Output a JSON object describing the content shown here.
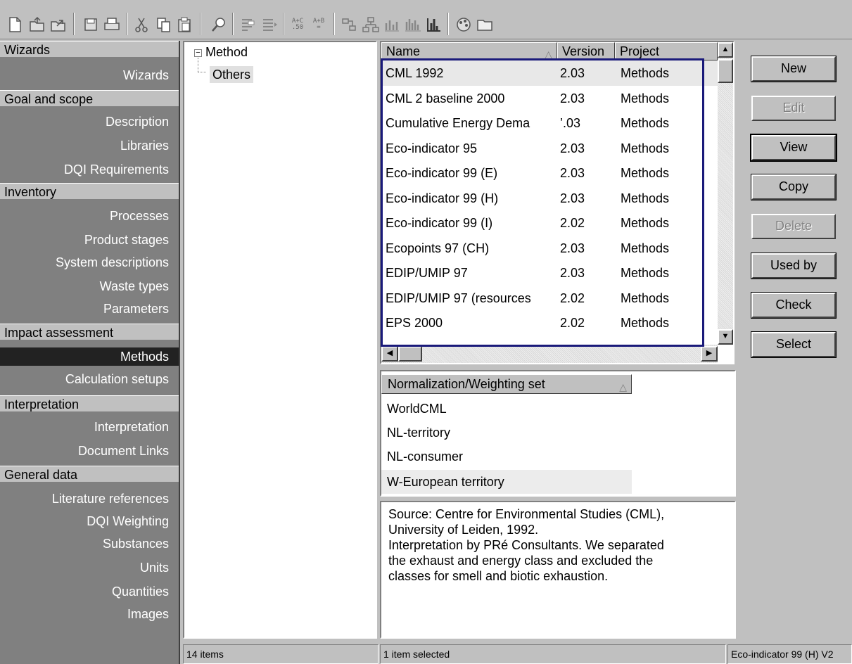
{
  "toolbar": {
    "icons": [
      "new-file-icon",
      "open-folder-icon",
      "open-up-icon",
      "save-icon",
      "print-icon",
      "cut-icon",
      "copy-icon",
      "paste-icon",
      "search-icon",
      "indent-left-icon",
      "indent-right-icon",
      "formula-icon",
      "compare-icon",
      "network-icon",
      "tree-icon",
      "bar-chart-icon",
      "bar-chart-2-icon",
      "chart-3-icon",
      "palette-icon",
      "folder-icon"
    ],
    "formula_a_top": "A+C",
    "formula_a_bot": ".50",
    "formula_b_top": "A+B",
    "formula_b_bot": "="
  },
  "navigator": {
    "sections": [
      {
        "title": "Wizards",
        "items": [
          "Wizards"
        ]
      },
      {
        "title": "Goal and scope",
        "items": [
          "Description",
          "Libraries",
          "DQI Requirements"
        ]
      },
      {
        "title": "Inventory",
        "items": [
          "Processes",
          "Product stages",
          "System descriptions",
          "Waste types",
          "Parameters"
        ]
      },
      {
        "title": "Impact assessment",
        "items": [
          "Methods",
          "Calculation setups"
        ]
      },
      {
        "title": "Interpretation",
        "items": [
          "Interpretation",
          "Document Links"
        ]
      },
      {
        "title": "General data",
        "items": [
          "Literature references",
          "DQI Weighting",
          "Substances",
          "Units",
          "Quantities",
          "Images"
        ]
      }
    ],
    "selected": "Methods"
  },
  "tree": {
    "root": "Method",
    "child": "Others",
    "expander": "−"
  },
  "methods": {
    "columns": [
      "Name",
      "Version",
      "Project"
    ],
    "sort_indicator": "△",
    "rows": [
      [
        "CML 1992",
        "2.03",
        "Methods"
      ],
      [
        "CML 2 baseline 2000",
        "2.03",
        "Methods"
      ],
      [
        "Cumulative Energy Dema",
        "’.03",
        "Methods"
      ],
      [
        "Eco-indicator 95",
        "2.03",
        "Methods"
      ],
      [
        "Eco-indicator 99 (E)",
        "2.03",
        "Methods"
      ],
      [
        "Eco-indicator 99 (H)",
        "2.03",
        "Methods"
      ],
      [
        "Eco-indicator 99 (I)",
        "2.02",
        "Methods"
      ],
      [
        "Ecopoints 97 (CH)",
        "2.03",
        "Methods"
      ],
      [
        "EDIP/UMIP 97",
        "2.03",
        "Methods"
      ],
      [
        "EDIP/UMIP 97 (resources",
        "2.02",
        "Methods"
      ],
      [
        "EPS 2000",
        "2.02",
        "Methods"
      ]
    ],
    "scroll_up": "▲",
    "scroll_down": "▼",
    "scroll_left": "◀",
    "scroll_right": "▶"
  },
  "buttons": {
    "new": "New",
    "edit": "Edit",
    "view": "View",
    "copy": "Copy",
    "delete": "Delete",
    "used_by": "Used by",
    "check": "Check",
    "select": "Select"
  },
  "normalization": {
    "header": "Normalization/Weighting set",
    "sort_indicator": "△",
    "items": [
      "WorldCML",
      "NL-territory",
      "NL-consumer",
      "W-European territory"
    ]
  },
  "description": {
    "text": "Source: Centre for Environmental Studies (CML),\nUniversity of Leiden, 1992.\nInterpretation by PRé Consultants. We separated\nthe exhaust and energy class and excluded the\nclasses for smell and biotic exhaustion."
  },
  "status": {
    "items_count": "14 items",
    "selected_count": "1 item selected",
    "current_method": "Eco-indicator 99 (H) V2"
  },
  "colors": {
    "highlight_border": "#1a1a7a",
    "nav_bg": "#808080",
    "nav_selected": "#222222"
  }
}
